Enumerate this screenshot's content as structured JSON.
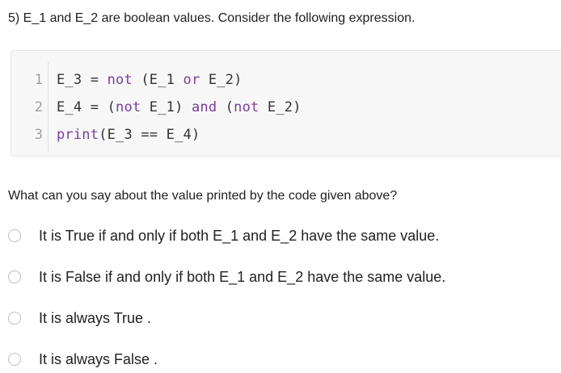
{
  "question": {
    "title": "5) E_1 and E_2 are boolean values. Consider the following expression.",
    "prompt": "What can you say about the value printed by the code given above?"
  },
  "code": {
    "lines": [
      {
        "number": "1",
        "parts": [
          "E_3 = ",
          "not",
          " (E_1 ",
          "or",
          " E_2)"
        ]
      },
      {
        "number": "2",
        "parts": [
          "E_4 = (",
          "not",
          " E_1) ",
          "and",
          " (",
          "not",
          " E_2)"
        ]
      },
      {
        "number": "3",
        "parts": [
          "print",
          "(E_3 == E_4)"
        ]
      }
    ]
  },
  "options": [
    {
      "label": "It is True if and only if both E_1 and E_2 have the same value."
    },
    {
      "label": "It is False if and only if both E_1 and E_2 have the same value."
    },
    {
      "label": "It is always True ."
    },
    {
      "label": "It is always False ."
    }
  ],
  "colors": {
    "keyword": "#7a3e9d",
    "code_text": "#333333",
    "line_number": "#9e9e9e",
    "code_background": "#f7f7f7",
    "radio_border": "#bdbdbd"
  }
}
